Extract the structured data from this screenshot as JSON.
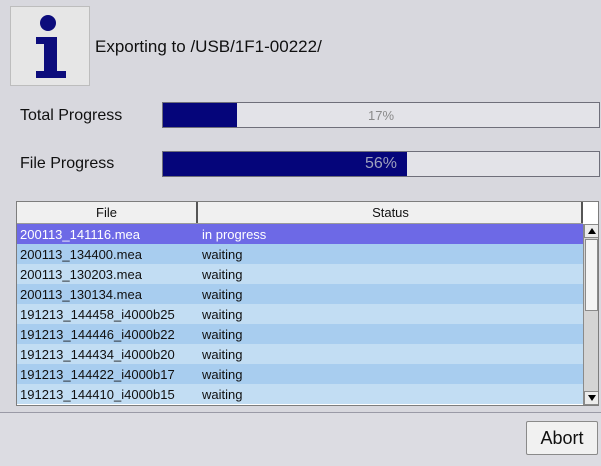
{
  "dialog": {
    "title": "Exporting to /USB/1F1-00222/",
    "icon": "info-icon"
  },
  "progress": {
    "total": {
      "label": "Total Progress",
      "value": 0.17,
      "text": "17%",
      "fill_color": "#05057a"
    },
    "file": {
      "label": "File Progress",
      "value": 0.56,
      "text": "56%",
      "fill_color": "#05057a"
    }
  },
  "table": {
    "columns": [
      "File",
      "Status"
    ],
    "rows": [
      {
        "file": "200113_141116.mea",
        "status": "in progress",
        "selected": true
      },
      {
        "file": "200113_134400.mea",
        "status": "waiting"
      },
      {
        "file": "200113_130203.mea",
        "status": "waiting"
      },
      {
        "file": "200113_130134.mea",
        "status": "waiting"
      },
      {
        "file": "191213_144458_i4000b25",
        "status": "waiting"
      },
      {
        "file": "191213_144446_i4000b22",
        "status": "waiting"
      },
      {
        "file": "191213_144434_i4000b20",
        "status": "waiting"
      },
      {
        "file": "191213_144422_i4000b17",
        "status": "waiting"
      },
      {
        "file": "191213_144410_i4000b15",
        "status": "waiting"
      }
    ],
    "colors": {
      "selected": "#6d69e6",
      "row_odd": "#a8cdef",
      "row_even": "#c2ddf3"
    }
  },
  "footer": {
    "abort_label": "Abort"
  }
}
